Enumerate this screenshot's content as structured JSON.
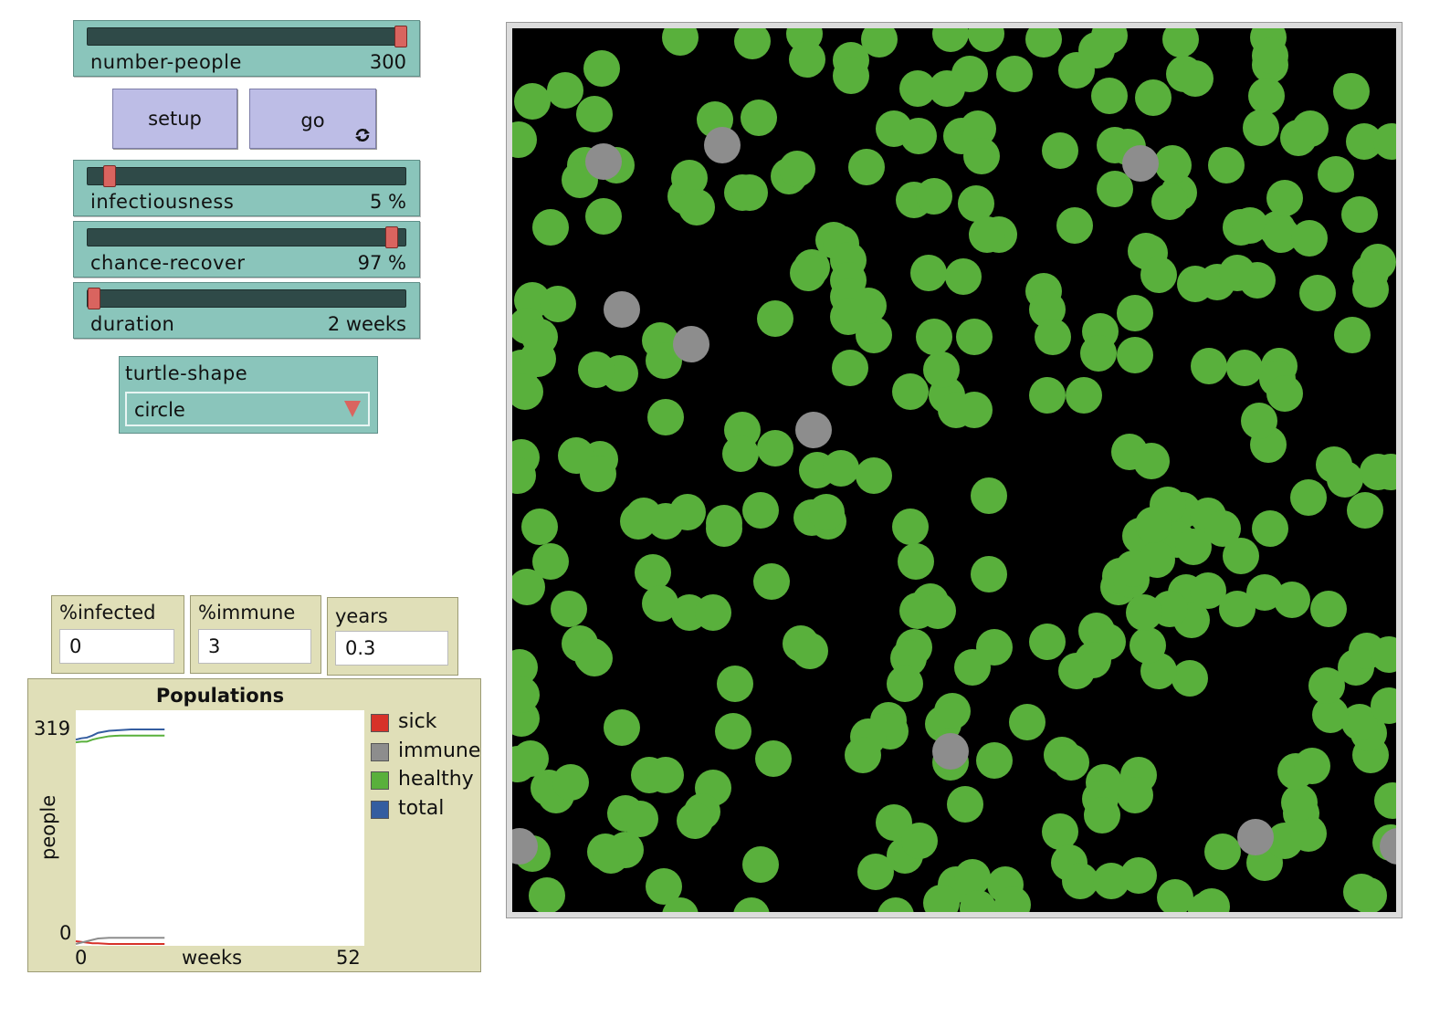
{
  "sliders": [
    {
      "id": "number-people",
      "label": "number-people",
      "value": "300",
      "fraction": 1.0
    },
    {
      "id": "infectiousness",
      "label": "infectiousness",
      "value": "5 %",
      "fraction": 0.05
    },
    {
      "id": "chance-recover",
      "label": "chance-recover",
      "value": "97 %",
      "fraction": 0.97
    },
    {
      "id": "duration",
      "label": "duration",
      "value": "2 weeks",
      "fraction": 0.0
    }
  ],
  "buttons": {
    "setup_label": "setup",
    "go_label": "go",
    "go_forever_icon": "forever-loop-icon"
  },
  "chooser": {
    "label": "turtle-shape",
    "value": "circle"
  },
  "monitors": [
    {
      "label": "%infected",
      "value": "0"
    },
    {
      "label": "%immune",
      "value": "3"
    },
    {
      "label": "years",
      "value": "0.3"
    }
  ],
  "plot": {
    "title": "Populations",
    "ylabel": "people",
    "xlabel": "weeks",
    "ymax_label": "319",
    "ymin_label": "0",
    "xmin_label": "0",
    "xmax_label": "52",
    "legend": [
      {
        "name": "sick",
        "color": "#d73229"
      },
      {
        "name": "immune",
        "color": "#8d8d8d"
      },
      {
        "name": "healthy",
        "color": "#59b03c"
      },
      {
        "name": "total",
        "color": "#345da0"
      }
    ]
  },
  "chart_data": {
    "type": "line",
    "title": "Populations",
    "xlabel": "weeks",
    "ylabel": "people",
    "xlim": [
      0,
      52
    ],
    "ylim": [
      0,
      319
    ],
    "series": [
      {
        "name": "sick",
        "x": [
          0,
          1,
          2,
          3,
          4,
          6,
          8,
          10,
          13,
          16
        ],
        "values": [
          4,
          3,
          2,
          1,
          1,
          0,
          0,
          0,
          0,
          0
        ]
      },
      {
        "name": "immune",
        "x": [
          0,
          1,
          2,
          3,
          4,
          6,
          8,
          10,
          13,
          16
        ],
        "values": [
          0,
          2,
          4,
          6,
          8,
          9,
          9,
          9,
          9,
          9
        ]
      },
      {
        "name": "healthy",
        "x": [
          0,
          1,
          2,
          3,
          4,
          6,
          8,
          10,
          13,
          16
        ],
        "values": [
          296,
          297,
          297,
          300,
          302,
          305,
          306,
          306,
          306,
          306
        ]
      },
      {
        "name": "total",
        "x": [
          0,
          1,
          2,
          3,
          4,
          6,
          8,
          10,
          13,
          16
        ],
        "values": [
          300,
          302,
          303,
          306,
          310,
          313,
          314,
          315,
          315,
          315
        ]
      }
    ]
  },
  "world": {
    "background": "#000000",
    "healthy_color": "#59b03c",
    "immune_color": "#8d8d8d"
  }
}
